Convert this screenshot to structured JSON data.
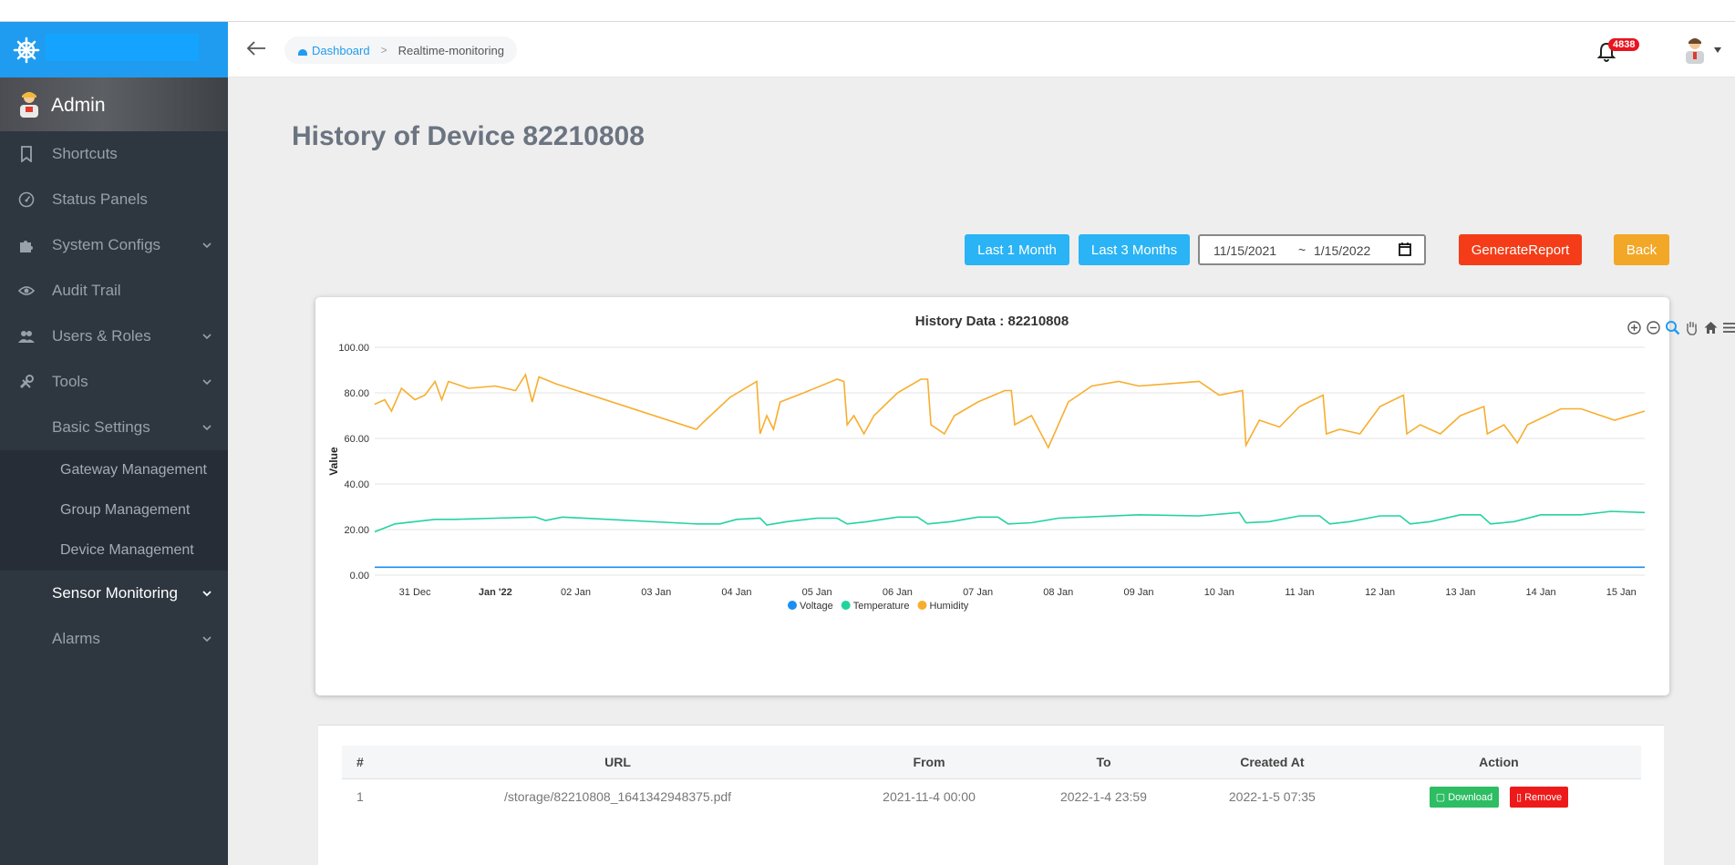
{
  "sidebar": {
    "admin_name": "Admin",
    "items": [
      {
        "label": "Shortcuts",
        "icon": "bookmark-icon"
      },
      {
        "label": "Status Panels",
        "icon": "gauge-icon"
      },
      {
        "label": "System Configs",
        "icon": "puzzle-icon"
      },
      {
        "label": "Audit Trail",
        "icon": "eye-icon"
      },
      {
        "label": "Users & Roles",
        "icon": "users-icon"
      },
      {
        "label": "Tools",
        "icon": "tools-icon"
      },
      {
        "label": "Basic Settings"
      }
    ],
    "submenu": [
      "Gateway Management",
      "Group Management",
      "Device Management"
    ],
    "items_after": [
      {
        "label": "Sensor Monitoring"
      },
      {
        "label": "Alarms"
      }
    ]
  },
  "topbar": {
    "breadcrumb_home": "Dashboard",
    "breadcrumb_sep": ">",
    "breadcrumb_current": "Realtime-monitoring",
    "notification_count": "4838"
  },
  "page": {
    "title": "History of Device 82210808",
    "btn_last_1_month": "Last 1 Month",
    "btn_last_3_months": "Last 3 Months",
    "date_from": "11/15/2021",
    "date_sep": "~",
    "date_to": "1/15/2022",
    "btn_generate_report": "GenerateReport",
    "btn_back": "Back"
  },
  "colors": {
    "accent": "#1f9cf0",
    "voltage": "#1a8ff0",
    "temperature": "#22d3a0",
    "humidity": "#f7ae2e"
  },
  "chart_data": {
    "type": "line",
    "title": "History Data : 82210808",
    "ylabel": "Value",
    "ylim": [
      0,
      100
    ],
    "y_ticks": [
      "0.00",
      "20.00",
      "40.00",
      "60.00",
      "80.00",
      "100.00"
    ],
    "x_range": [
      "2021-12-30 12:00",
      "2022-01-15 07:00"
    ],
    "x_ticks": [
      {
        "label": "31 Dec",
        "date": "2021-12-31"
      },
      {
        "label": "Jan '22",
        "date": "2022-01-01",
        "bold": true
      },
      {
        "label": "02 Jan",
        "date": "2022-01-02"
      },
      {
        "label": "03 Jan",
        "date": "2022-01-03"
      },
      {
        "label": "04 Jan",
        "date": "2022-01-04"
      },
      {
        "label": "05 Jan",
        "date": "2022-01-05"
      },
      {
        "label": "06 Jan",
        "date": "2022-01-06"
      },
      {
        "label": "07 Jan",
        "date": "2022-01-07"
      },
      {
        "label": "08 Jan",
        "date": "2022-01-08"
      },
      {
        "label": "09 Jan",
        "date": "2022-01-09"
      },
      {
        "label": "10 Jan",
        "date": "2022-01-10"
      },
      {
        "label": "11 Jan",
        "date": "2022-01-11"
      },
      {
        "label": "12 Jan",
        "date": "2022-01-12"
      },
      {
        "label": "13 Jan",
        "date": "2022-01-13"
      },
      {
        "label": "14 Jan",
        "date": "2022-01-14"
      },
      {
        "label": "15 Jan",
        "date": "2022-01-15"
      }
    ],
    "legend": "bottom-center",
    "grid": true,
    "series": [
      {
        "name": "Voltage",
        "color": "#1a8ff0",
        "points": [
          [
            "2021-12-30 12:00",
            3.5
          ],
          [
            "2022-01-15 07:00",
            3.5
          ]
        ]
      },
      {
        "name": "Temperature",
        "color": "#22d3a0",
        "points": [
          [
            "2021-12-30 12:00",
            19
          ],
          [
            "2021-12-30 18:00",
            22.5
          ],
          [
            "2021-12-31 00:00",
            23.5
          ],
          [
            "2021-12-31 06:00",
            24.5
          ],
          [
            "2021-12-31 12:00",
            24.5
          ],
          [
            "2022-01-01 00:00",
            25
          ],
          [
            "2022-01-01 12:00",
            25.5
          ],
          [
            "2022-01-01 15:00",
            24
          ],
          [
            "2022-01-01 20:00",
            25.5
          ],
          [
            "2022-01-03 12:00",
            22.5
          ],
          [
            "2022-01-03 19:00",
            22.5
          ],
          [
            "2022-01-04 00:00",
            24.5
          ],
          [
            "2022-01-04 07:00",
            25
          ],
          [
            "2022-01-04 09:00",
            22
          ],
          [
            "2022-01-04 15:00",
            23.5
          ],
          [
            "2022-01-05 00:00",
            25
          ],
          [
            "2022-01-05 06:00",
            25
          ],
          [
            "2022-01-05 09:00",
            22.5
          ],
          [
            "2022-01-05 15:00",
            23.5
          ],
          [
            "2022-01-06 00:00",
            25.5
          ],
          [
            "2022-01-06 06:00",
            25.5
          ],
          [
            "2022-01-06 09:00",
            22.5
          ],
          [
            "2022-01-06 16:00",
            23.5
          ],
          [
            "2022-01-07 00:00",
            25.5
          ],
          [
            "2022-01-07 06:00",
            25.5
          ],
          [
            "2022-01-07 09:00",
            22.5
          ],
          [
            "2022-01-07 16:00",
            23
          ],
          [
            "2022-01-08 00:00",
            25
          ],
          [
            "2022-01-09 00:00",
            26.5
          ],
          [
            "2022-01-09 18:00",
            26
          ],
          [
            "2022-01-10 06:00",
            27.5
          ],
          [
            "2022-01-10 08:00",
            23
          ],
          [
            "2022-01-10 15:00",
            23.5
          ],
          [
            "2022-01-11 00:00",
            26
          ],
          [
            "2022-01-11 06:00",
            26
          ],
          [
            "2022-01-11 09:00",
            22.5
          ],
          [
            "2022-01-11 15:00",
            23.5
          ],
          [
            "2022-01-12 00:00",
            26
          ],
          [
            "2022-01-12 06:00",
            26
          ],
          [
            "2022-01-12 09:00",
            22.5
          ],
          [
            "2022-01-12 15:00",
            23.5
          ],
          [
            "2022-01-13 00:00",
            26.5
          ],
          [
            "2022-01-13 06:00",
            26.5
          ],
          [
            "2022-01-13 09:00",
            22.5
          ],
          [
            "2022-01-13 16:00",
            23.5
          ],
          [
            "2022-01-14 00:00",
            26.5
          ],
          [
            "2022-01-14 12:00",
            26.5
          ],
          [
            "2022-01-14 21:00",
            28
          ],
          [
            "2022-01-15 07:00",
            27.5
          ]
        ]
      },
      {
        "name": "Humidity",
        "color": "#f7ae2e",
        "points": [
          [
            "2021-12-30 12:00",
            75
          ],
          [
            "2021-12-30 15:00",
            77
          ],
          [
            "2021-12-30 17:00",
            72
          ],
          [
            "2021-12-30 20:00",
            82
          ],
          [
            "2021-12-31 00:00",
            77
          ],
          [
            "2021-12-31 03:00",
            79
          ],
          [
            "2021-12-31 06:00",
            85
          ],
          [
            "2021-12-31 08:00",
            77
          ],
          [
            "2021-12-31 10:00",
            85
          ],
          [
            "2021-12-31 16:00",
            82
          ],
          [
            "2022-01-01 00:00",
            83
          ],
          [
            "2022-01-01 06:00",
            81
          ],
          [
            "2022-01-01 09:00",
            88
          ],
          [
            "2022-01-01 11:00",
            76
          ],
          [
            "2022-01-01 13:00",
            87
          ],
          [
            "2022-01-01 18:00",
            84
          ],
          [
            "2022-01-03 12:00",
            64
          ],
          [
            "2022-01-03 14:00",
            67
          ],
          [
            "2022-01-03 22:00",
            78
          ],
          [
            "2022-01-04 06:00",
            85
          ],
          [
            "2022-01-04 07:00",
            62
          ],
          [
            "2022-01-04 09:00",
            70
          ],
          [
            "2022-01-04 11:00",
            64
          ],
          [
            "2022-01-04 13:00",
            76
          ],
          [
            "2022-01-04 20:00",
            80
          ],
          [
            "2022-01-05 06:00",
            86
          ],
          [
            "2022-01-05 08:00",
            85
          ],
          [
            "2022-01-05 09:00",
            66
          ],
          [
            "2022-01-05 11:00",
            70
          ],
          [
            "2022-01-05 14:00",
            62
          ],
          [
            "2022-01-05 17:00",
            70
          ],
          [
            "2022-01-06 00:00",
            80
          ],
          [
            "2022-01-06 07:00",
            86
          ],
          [
            "2022-01-06 09:00",
            86
          ],
          [
            "2022-01-06 10:00",
            66
          ],
          [
            "2022-01-06 14:00",
            62
          ],
          [
            "2022-01-06 17:00",
            70
          ],
          [
            "2022-01-07 00:00",
            76
          ],
          [
            "2022-01-07 08:00",
            81
          ],
          [
            "2022-01-07 10:00",
            81
          ],
          [
            "2022-01-07 11:00",
            66
          ],
          [
            "2022-01-07 16:00",
            70
          ],
          [
            "2022-01-07 21:00",
            56
          ],
          [
            "2022-01-08 03:00",
            76
          ],
          [
            "2022-01-08 10:00",
            83
          ],
          [
            "2022-01-08 18:00",
            85
          ],
          [
            "2022-01-09 00:00",
            83
          ],
          [
            "2022-01-09 18:00",
            85
          ],
          [
            "2022-01-10 00:00",
            79
          ],
          [
            "2022-01-10 07:00",
            81
          ],
          [
            "2022-01-10 08:00",
            57
          ],
          [
            "2022-01-10 12:00",
            68
          ],
          [
            "2022-01-10 18:00",
            65
          ],
          [
            "2022-01-11 00:00",
            74
          ],
          [
            "2022-01-11 07:00",
            79
          ],
          [
            "2022-01-11 08:00",
            62
          ],
          [
            "2022-01-11 12:00",
            64
          ],
          [
            "2022-01-11 18:00",
            62
          ],
          [
            "2022-01-12 00:00",
            74
          ],
          [
            "2022-01-12 07:00",
            79
          ],
          [
            "2022-01-12 08:00",
            62
          ],
          [
            "2022-01-12 12:00",
            66
          ],
          [
            "2022-01-12 18:00",
            62
          ],
          [
            "2022-01-13 00:00",
            70
          ],
          [
            "2022-01-13 07:00",
            74
          ],
          [
            "2022-01-13 08:00",
            62
          ],
          [
            "2022-01-13 13:00",
            66
          ],
          [
            "2022-01-13 17:00",
            58
          ],
          [
            "2022-01-13 20:00",
            66
          ],
          [
            "2022-01-14 06:00",
            73
          ],
          [
            "2022-01-14 12:00",
            73
          ],
          [
            "2022-01-14 22:00",
            68
          ],
          [
            "2022-01-15 07:00",
            72
          ]
        ]
      }
    ]
  },
  "table": {
    "headers": [
      "#",
      "URL",
      "From",
      "To",
      "Created At",
      "Action"
    ],
    "rows": [
      {
        "index": "1",
        "url": "/storage/82210808_1641342948375.pdf",
        "from": "2021-11-4 00:00",
        "to": "2022-1-4 23:59",
        "created": "2022-1-5 07:35",
        "download": "Download",
        "remove": "Remove"
      }
    ]
  }
}
